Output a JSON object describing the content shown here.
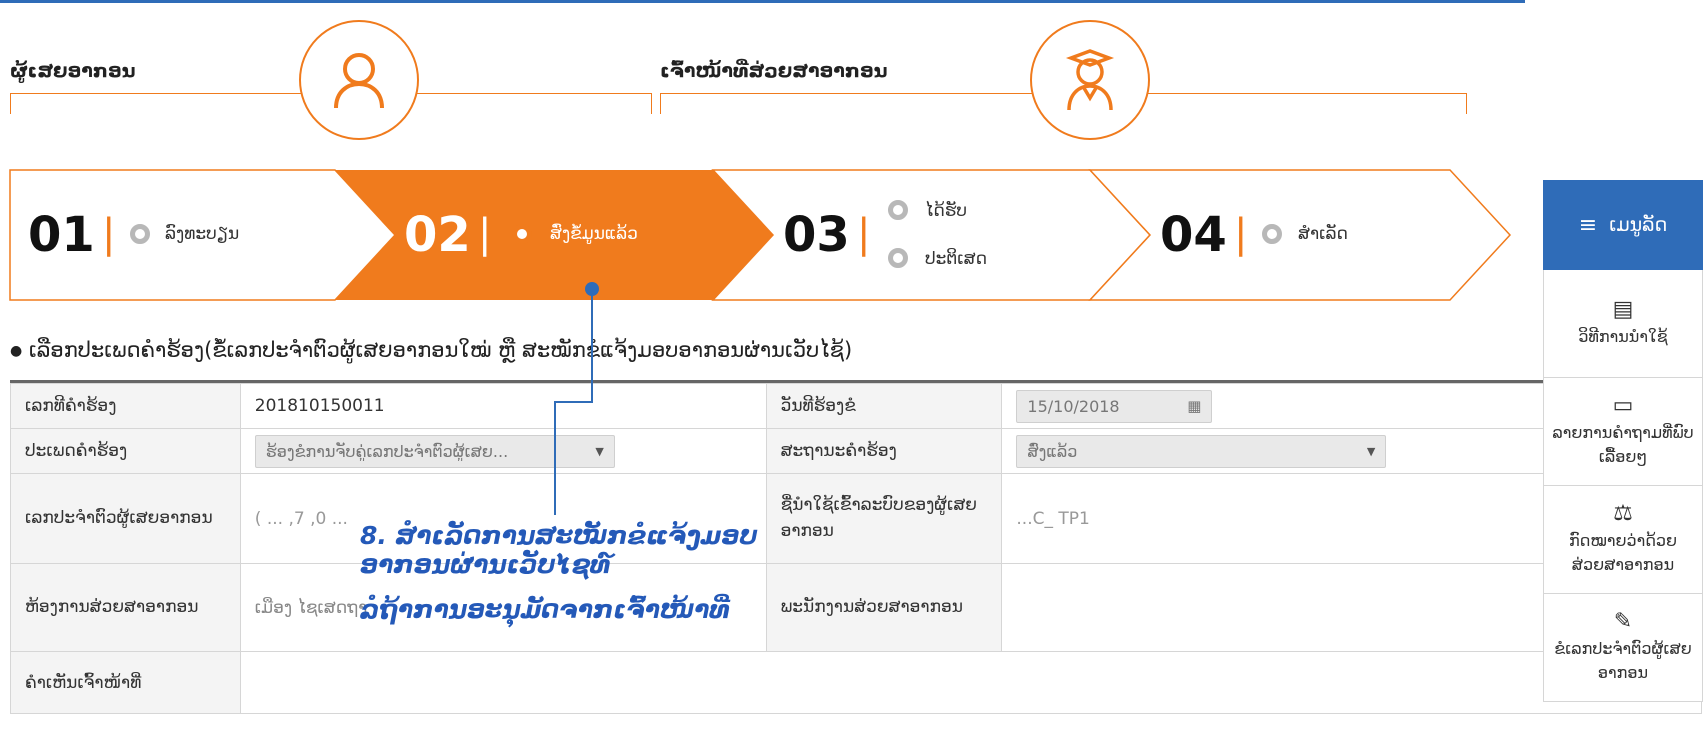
{
  "roles": {
    "taxpayer": {
      "label": "ຜູ້ເສຍອາກອນ",
      "icon": "person-icon"
    },
    "officer": {
      "label": "ເຈົ້າໜ້າທີ່ສ່ວຍສາອາກອນ",
      "icon": "officer-icon"
    }
  },
  "steps": [
    {
      "num": "01",
      "label": "ລົງທະບຽນ",
      "state": "inactive"
    },
    {
      "num": "02",
      "label": "ສົ່ງຂໍ້ມູນແລ້ວ",
      "state": "active"
    },
    {
      "num": "03",
      "label_a": "ໄດ້ຮັບ",
      "label_b": "ປະຕິເສດ",
      "state": "inactive"
    },
    {
      "num": "04",
      "label": "ສຳເລັດ",
      "state": "inactive"
    }
  ],
  "colors": {
    "accent": "#f07b1d",
    "primary": "#2f6cb8",
    "overlay_text": "#2459b8"
  },
  "instruction": "ເລືອກປະເພດຄຳຮ້ອງ(ຂໍ້ເລກປະຈຳຕົວຜູ້ເສຍອາກອນໃໝ່ ຫຼື ສະໝັກຂໍແຈ້ງມອບອາກອນຜ່ານເວັບໄຊ້)",
  "form": {
    "request_no_label": "ເລກທີຄຳຮ້ອງ",
    "request_no_value": "201810150011",
    "request_date_label": "ວັນທີຮ້ອງຂໍ",
    "request_date_value": "15/10/2018",
    "request_type_label": "ປະເພດຄຳຮ້ອງ",
    "request_type_value": "ຮ້ອງຂໍການຈັບຄູ່ເລກປະຈຳຕົວຜູ້ເສຍ...",
    "request_status_label": "ສະຖານະຄຳຮ້ອງ",
    "request_status_value": "ສົ່ງແລ້ວ",
    "tin_label": "ເລກປະຈຳຕົວຜູ້ເສຍອາກອນ",
    "tin_value": "( ... ,7 ,0 ...",
    "username_label": "ຊື່ນຳໃຊ້ເຂົ້າລະບົບຂອງຜູ້ເສຍອາກອນ",
    "username_value": "...C_ TP1",
    "office_label": "ຫ້ອງການສ່ວຍສາອາກອນ",
    "office_value": "ເມືອງ ໄຊເສດຖາ",
    "staff_label": "ພະນັກງານສ່ວຍສາອາກອນ",
    "staff_value": "",
    "comment_label": "ຄຳເຫັນເຈົ້າໜ້າທີ່",
    "comment_value": ""
  },
  "overlay": {
    "line1": "8. ສຳເລັດການສະໝັກຂໍແຈ້ງມອບ",
    "line2": "ອາກອນຜ່ານເວັບໄຊທ໌",
    "line3": "ລໍຖ້າການອະນຸມັດຈາກເຈົ້າໜ້າທີ່"
  },
  "sidebar": {
    "header": "ເມນູລັດ",
    "items": [
      {
        "label": "ວິທີການນຳໃຊ້",
        "icon": "list-icon"
      },
      {
        "label": "ລາຍການຄຳຖາມທີ່ພົບເລື້ອຍໆ",
        "icon": "comment-icon"
      },
      {
        "label": "ກົດໝາຍວ່າດ້ວຍສ່ວຍສາອາກອນ",
        "icon": "gavel-icon"
      },
      {
        "label": "ຂໍເລກປະຈຳຕົວຜູ້ເສຍອາກອນ",
        "icon": "edit-icon"
      }
    ]
  }
}
